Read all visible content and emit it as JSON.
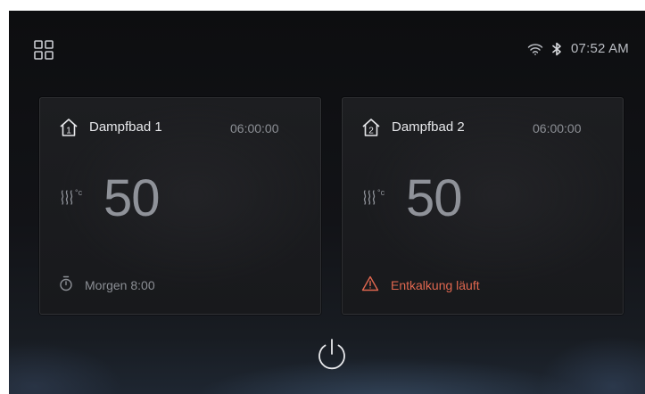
{
  "header": {
    "menu_icon": "grid-menu-icon",
    "wifi_icon": "wifi-icon",
    "bluetooth_icon": "bluetooth-icon",
    "time": "07:52 AM"
  },
  "rooms": [
    {
      "number": "1",
      "name": "Dampfbad 1",
      "timer": "06:00:00",
      "temperature": "50",
      "temp_unit": "°c",
      "footer_icon": "stopwatch-icon",
      "footer_text": "Morgen 8:00"
    },
    {
      "number": "2",
      "name": "Dampfbad 2",
      "timer": "06:00:00",
      "temperature": "50",
      "temp_unit": "°c",
      "footer_icon": "warning-icon",
      "footer_text": "Entkalkung läuft"
    }
  ],
  "colors": {
    "background": "#121317",
    "card": "#1b1c1f",
    "text_primary": "#e6e7ea",
    "text_muted": "#8b8e94",
    "warning": "#e0674f"
  },
  "power_icon": "power-icon"
}
